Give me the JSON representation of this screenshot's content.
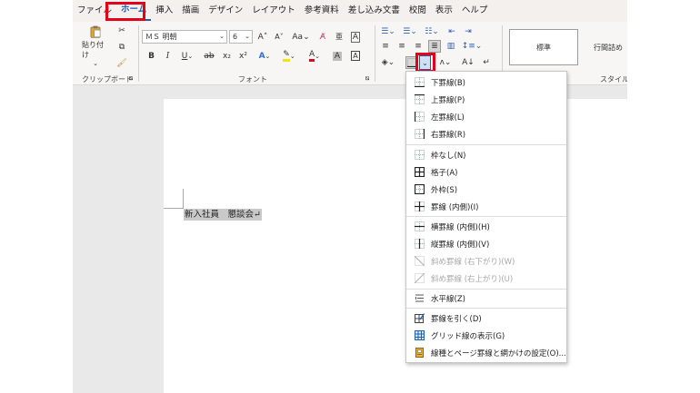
{
  "menu": {
    "tabs": [
      "ファイル",
      "ホーム",
      "挿入",
      "描画",
      "デザイン",
      "レイアウト",
      "参考資料",
      "差し込み文書",
      "校閲",
      "表示",
      "ヘルプ"
    ],
    "active": "ホーム"
  },
  "ribbon": {
    "clipboard": {
      "paste_label": "貼り付け",
      "group_label": "クリップボード"
    },
    "font": {
      "font_name": "ＭＳ 明朝",
      "font_size": "6",
      "group_label": "フォント"
    },
    "styles": {
      "style1": "標準",
      "style2": "行間詰め",
      "group_label": "スタイル"
    }
  },
  "document": {
    "text": "新入社員　懇談会↵"
  },
  "borders_menu": {
    "items": [
      {
        "label": "下罫線(B)",
        "icon": "border-bottom-icon",
        "disabled": false
      },
      {
        "label": "上罫線(P)",
        "icon": "border-top-icon",
        "disabled": false
      },
      {
        "label": "左罫線(L)",
        "icon": "border-left-icon",
        "disabled": false
      },
      {
        "label": "右罫線(R)",
        "icon": "border-right-icon",
        "disabled": false
      },
      {
        "label": "枠なし(N)",
        "icon": "border-none-icon",
        "disabled": false
      },
      {
        "label": "格子(A)",
        "icon": "border-all-icon",
        "disabled": false
      },
      {
        "label": "外枠(S)",
        "icon": "border-outside-icon",
        "disabled": false
      },
      {
        "label": "罫線 (内側)(I)",
        "icon": "border-inside-icon",
        "disabled": false
      },
      {
        "label": "横罫線 (内側)(H)",
        "icon": "border-inside-horizontal-icon",
        "disabled": false
      },
      {
        "label": "縦罫線 (内側)(V)",
        "icon": "border-inside-vertical-icon",
        "disabled": false
      },
      {
        "label": "斜め罫線 (右下がり)(W)",
        "icon": "diagonal-down-border-icon",
        "disabled": true
      },
      {
        "label": "斜め罫線 (右上がり)(U)",
        "icon": "diagonal-up-border-icon",
        "disabled": true
      },
      {
        "label": "水平線(Z)",
        "icon": "horizontal-line-icon",
        "disabled": false
      },
      {
        "label": "罫線を引く(D)",
        "icon": "draw-table-icon",
        "disabled": false
      },
      {
        "label": "グリッド線の表示(G)",
        "icon": "view-gridlines-icon",
        "disabled": false
      },
      {
        "label": "線種とページ罫線と網かけの設定(O)...",
        "icon": "borders-and-shading-icon",
        "disabled": false
      }
    ]
  },
  "colors": {
    "highlight_red": "#e5001a",
    "accent_blue": "#1b5fb0"
  }
}
